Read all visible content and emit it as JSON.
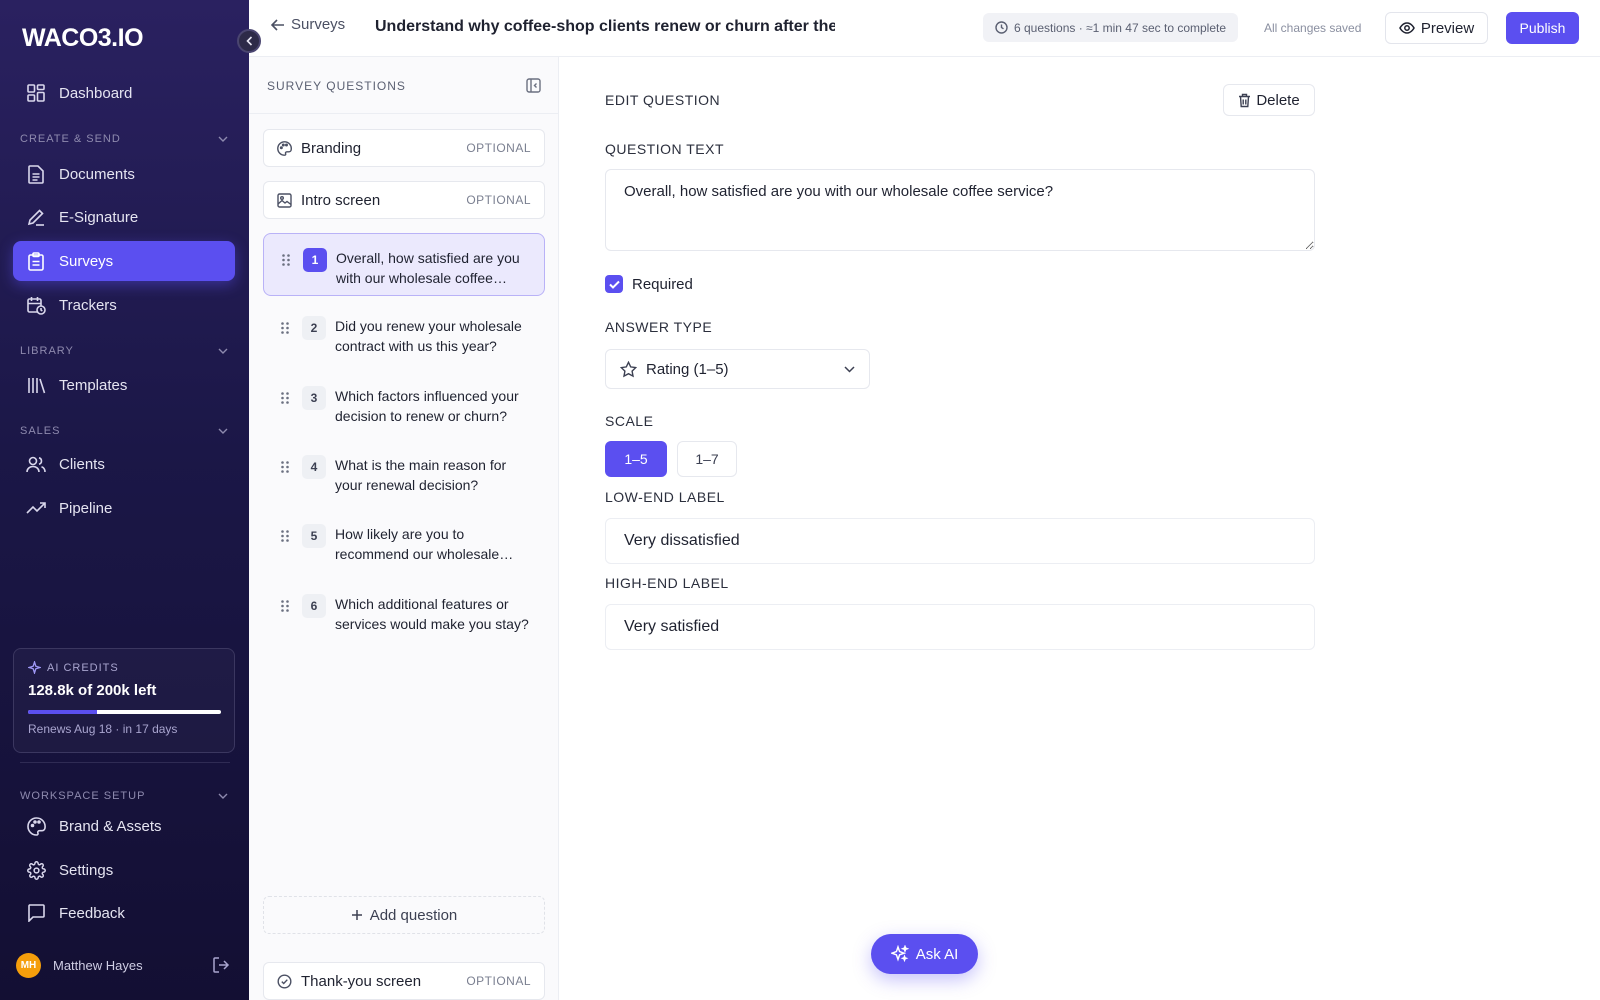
{
  "app": {
    "logo": "WACO3.IO"
  },
  "sidebar": {
    "dashboard": "Dashboard",
    "section_create": "CREATE & SEND",
    "documents": "Documents",
    "esignature": "E-Signature",
    "surveys": "Surveys",
    "trackers": "Trackers",
    "section_library": "LIBRARY",
    "templates": "Templates",
    "section_sales": "SALES",
    "clients": "Clients",
    "pipeline": "Pipeline",
    "credits": {
      "label": "AI CREDITS",
      "value": "128.8k of 200k left",
      "fill_fraction": 0.356,
      "renews": "Renews Aug 18 · in 17 days"
    },
    "section_workspace": "WORKSPACE SETUP",
    "brand": "Brand & Assets",
    "settings": "Settings",
    "feedback": "Feedback",
    "user": {
      "initials": "MH",
      "name": "Matthew Hayes"
    }
  },
  "header": {
    "back_label": "Surveys",
    "title": "Understand why coffee-shop clients renew or churn after thei",
    "meta": "6 questions · ≈1 min 47 sec to complete",
    "saved": "All changes saved",
    "preview": "Preview",
    "publish": "Publish"
  },
  "questions_panel": {
    "title": "SURVEY QUESTIONS",
    "branding": {
      "label": "Branding",
      "tag": "OPTIONAL"
    },
    "intro": {
      "label": "Intro screen",
      "tag": "OPTIONAL"
    },
    "questions": [
      {
        "num": "1",
        "text": "Overall, how satisfied are you with our wholesale coffee service?"
      },
      {
        "num": "2",
        "text": "Did you renew your wholesale contract with us this year?"
      },
      {
        "num": "3",
        "text": "Which factors influenced your decision to renew or churn?"
      },
      {
        "num": "4",
        "text": "What is the main reason for your renewal decision?"
      },
      {
        "num": "5",
        "text": "How likely are you to recommend our wholesale coffee service?"
      },
      {
        "num": "6",
        "text": "Which additional features or services would make you stay?"
      }
    ],
    "add_question": "Add question",
    "thankyou": {
      "label": "Thank-you screen",
      "tag": "OPTIONAL"
    }
  },
  "editor": {
    "title": "EDIT QUESTION",
    "delete": "Delete",
    "question_text_label": "QUESTION TEXT",
    "question_text": "Overall, how satisfied are you with our wholesale coffee service?",
    "required_label": "Required",
    "answer_type_label": "ANSWER TYPE",
    "answer_type": "Rating (1–5)",
    "scale_label": "SCALE",
    "scale_options": [
      "1–5",
      "1–7"
    ],
    "low_label_title": "LOW-END LABEL",
    "low_label_value": "Very dissatisfied",
    "high_label_title": "HIGH-END LABEL",
    "high_label_value": "Very satisfied"
  },
  "ask_ai": "Ask AI",
  "colors": {
    "accent": "#5b4ff0",
    "sidebar_top": "#2a2160",
    "sidebar_bottom": "#130f33"
  }
}
